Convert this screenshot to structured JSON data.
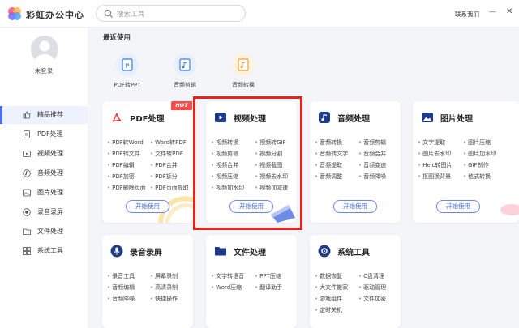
{
  "app": {
    "title": "彩虹办公中心"
  },
  "search": {
    "placeholder": "搜索工具"
  },
  "header": {
    "contact": "联系我们",
    "minimize": "—",
    "close": "✕"
  },
  "user": {
    "login_label": "未登录"
  },
  "sidebar": {
    "items": [
      {
        "label": "精品推荐",
        "icon": "thumbs-up-icon"
      },
      {
        "label": "PDF处理",
        "icon": "pdf-file-icon"
      },
      {
        "label": "视频处理",
        "icon": "video-icon"
      },
      {
        "label": "音频处理",
        "icon": "music-note-icon"
      },
      {
        "label": "图片处理",
        "icon": "image-icon"
      },
      {
        "label": "录音录屏",
        "icon": "record-icon"
      },
      {
        "label": "文件处理",
        "icon": "folder-icon"
      },
      {
        "label": "系统工具",
        "icon": "system-tools-icon"
      }
    ]
  },
  "recent": {
    "title": "最近使用",
    "items": [
      {
        "label": "PDF转PPT",
        "icon": "pdf-to-ppt-icon"
      },
      {
        "label": "音频剪辑",
        "icon": "audio-cut-icon"
      },
      {
        "label": "音频转换",
        "icon": "audio-convert-icon"
      }
    ]
  },
  "cards": {
    "pdf": {
      "title": "PDF处理",
      "badge": "HOT",
      "button": "开始使用",
      "left": [
        "PDF转Word",
        "PDF转文件",
        "PDF编辑",
        "PDF加密",
        "PDF删除页面"
      ],
      "right": [
        "Word转PDF",
        "文件转PDF",
        "PDF合并",
        "PDF拆分",
        "PDF页面提取"
      ]
    },
    "video": {
      "title": "视频处理",
      "button": "开始使用",
      "left": [
        "视频转换",
        "视频剪辑",
        "视频合并",
        "视频压缩",
        "视频加水印"
      ],
      "right": [
        "视频转GIF",
        "视频分割",
        "视频截图",
        "视频去水印",
        "视频加减速"
      ]
    },
    "audio": {
      "title": "音频处理",
      "button": "开始使用",
      "left": [
        "音频转换",
        "音频转文字",
        "音频提取",
        "音频调整"
      ],
      "right": [
        "音频剪辑",
        "音频合并",
        "音频变速",
        "音频降噪"
      ]
    },
    "image": {
      "title": "图片处理",
      "button": "开始使用",
      "left": [
        "文字提取",
        "图片去水印",
        "Heic转图片",
        "抠图换背景"
      ],
      "right": [
        "图片压缩",
        "图片加水印",
        "GIF制作",
        "格式转换"
      ]
    },
    "record": {
      "title": "录音录屏",
      "left": [
        "录音工具",
        "音频编辑",
        "音频降噪"
      ],
      "right": [
        "屏幕录制",
        "高清录制",
        "快捷操作"
      ]
    },
    "file": {
      "title": "文件处理",
      "left": [
        "文字转语音",
        "Word压缩"
      ],
      "right": [
        "PPT压缩",
        "翻译助手"
      ]
    },
    "system": {
      "title": "系统工具",
      "left": [
        "数据恢复",
        "大文件搬家",
        "游戏组件",
        "定时关机"
      ],
      "right": [
        "C盘清理",
        "驱动管理",
        "文件加密"
      ]
    }
  },
  "colors": {
    "accent": "#4a6cf7",
    "highlight": "#e1251b",
    "hot": "#ff4a4a"
  }
}
